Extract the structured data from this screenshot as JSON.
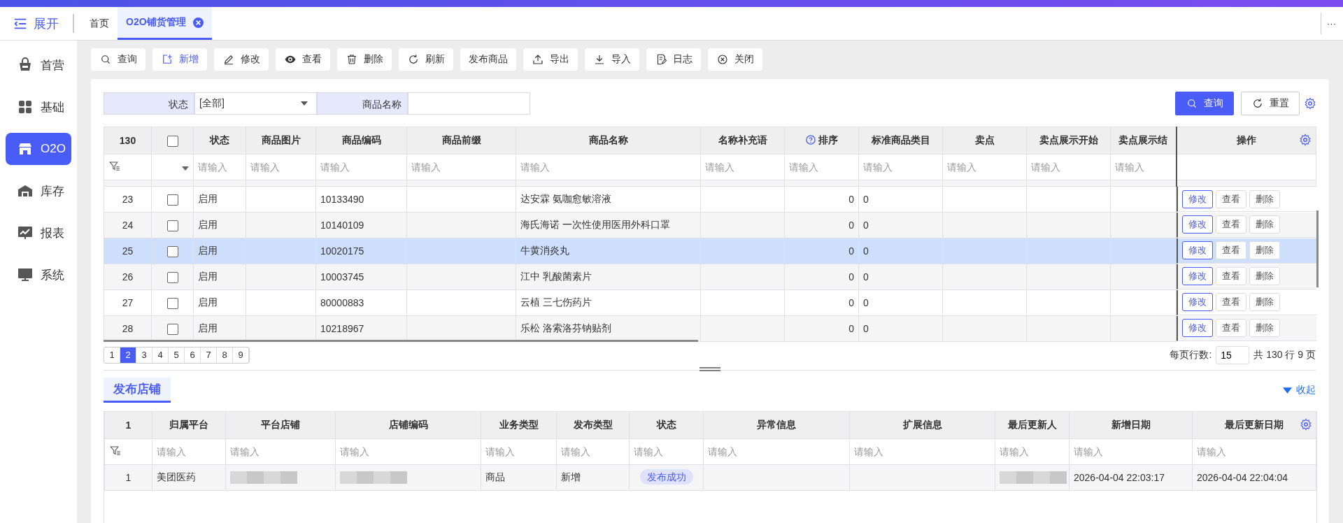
{
  "top_bar": {
    "toggle": "展开",
    "more": "···"
  },
  "tabs": [
    {
      "label": "首页",
      "selected": false,
      "closable": false
    },
    {
      "label": "O2O铺货管理",
      "selected": true,
      "closable": true
    }
  ],
  "sidebar": {
    "items": [
      {
        "label": "首营",
        "selected": false
      },
      {
        "label": "基础",
        "selected": false
      },
      {
        "label": "O2O",
        "selected": true
      },
      {
        "label": "库存",
        "selected": false
      },
      {
        "label": "报表",
        "selected": false
      },
      {
        "label": "系统",
        "selected": false
      }
    ]
  },
  "toolbar": [
    {
      "label": "查询",
      "highlighted": false
    },
    {
      "label": "新增",
      "highlighted": true
    },
    {
      "label": "修改",
      "highlighted": false
    },
    {
      "label": "查看",
      "highlighted": false
    },
    {
      "label": "删除",
      "highlighted": false
    },
    {
      "label": "刷新",
      "highlighted": false
    },
    {
      "label": "发布商品",
      "highlighted": false
    },
    {
      "label": "导出",
      "highlighted": false
    },
    {
      "label": "导入",
      "highlighted": false
    },
    {
      "label": "日志",
      "highlighted": false
    },
    {
      "label": "关闭",
      "highlighted": false
    }
  ],
  "search_form": {
    "fields": [
      {
        "label": "状态",
        "kind": "select",
        "value": "[全部]"
      },
      {
        "label": "商品名称",
        "kind": "text"
      }
    ],
    "buttons": [
      {
        "label": "查询",
        "primary": true
      },
      {
        "label": "重置",
        "primary": false
      }
    ]
  },
  "product_table": {
    "count": "130",
    "all_checked": false,
    "columns": [
      {
        "label": "状态",
        "placeholder": "请输入"
      },
      {
        "label": "商品图片",
        "placeholder": "请输入"
      },
      {
        "label": "商品编码",
        "placeholder": "请输入"
      },
      {
        "label": "商品前缀",
        "placeholder": "请输入"
      },
      {
        "label": "商品名称",
        "placeholder": "请输入"
      },
      {
        "label": "名称补充语",
        "placeholder": "请输入"
      },
      {
        "label": "排序",
        "placeholder": "请输入",
        "help": true
      },
      {
        "label": "标准商品类目",
        "placeholder": "请输入"
      },
      {
        "label": "卖点",
        "placeholder": "请输入"
      },
      {
        "label": "卖点展示开始",
        "placeholder": "请输入"
      },
      {
        "label": "卖点展示结",
        "placeholder": "请输入"
      }
    ],
    "actions_header": "操作",
    "rows": [
      {
        "no": "23",
        "checked": false,
        "selected": false,
        "status": "启用",
        "code": "10133490",
        "name": "达安霖 氨咖愈敏溶液",
        "sort": "0",
        "category": "0",
        "actions": [
          "修改",
          "查看",
          "删除"
        ]
      },
      {
        "no": "24",
        "checked": false,
        "selected": false,
        "status": "启用",
        "code": "10140109",
        "name": "海氏海诺 一次性使用医用外科口罩",
        "sort": "0",
        "category": "0",
        "actions": [
          "修改",
          "查看",
          "删除"
        ]
      },
      {
        "no": "25",
        "checked": false,
        "selected": true,
        "status": "启用",
        "code": "10020175",
        "name": "牛黄消炎丸",
        "sort": "0",
        "category": "0",
        "actions": [
          "修改",
          "查看",
          "删除"
        ]
      },
      {
        "no": "26",
        "checked": false,
        "selected": false,
        "status": "启用",
        "code": "10003745",
        "name": "江中 乳酸菌素片",
        "sort": "0",
        "category": "0",
        "actions": [
          "修改",
          "查看",
          "删除"
        ]
      },
      {
        "no": "27",
        "checked": false,
        "selected": false,
        "status": "启用",
        "code": "80000883",
        "name": "云植 三七伤药片",
        "sort": "0",
        "category": "0",
        "actions": [
          "修改",
          "查看",
          "删除"
        ]
      },
      {
        "no": "28",
        "checked": false,
        "selected": false,
        "status": "启用",
        "code": "10218967",
        "name": "乐松 洛索洛芬钠贴剂",
        "sort": "0",
        "category": "0",
        "actions": [
          "修改",
          "查看",
          "删除"
        ]
      }
    ]
  },
  "pagination": {
    "pages": [
      {
        "label": "1",
        "selected": false
      },
      {
        "label": "2",
        "selected": true
      },
      {
        "label": "3",
        "selected": false
      },
      {
        "label": "4",
        "selected": false
      },
      {
        "label": "5",
        "selected": false
      },
      {
        "label": "6",
        "selected": false
      },
      {
        "label": "7",
        "selected": false
      },
      {
        "label": "8",
        "selected": false
      },
      {
        "label": "9",
        "selected": false
      }
    ],
    "page_size_label": "每页行数:",
    "page_size": "15",
    "summary": "共 130 行 9 页"
  },
  "store_section": {
    "tab": "发布店铺",
    "collapse": "收起",
    "table": {
      "count": "1",
      "columns": [
        {
          "label": "归属平台",
          "placeholder": "请输入"
        },
        {
          "label": "平台店铺",
          "placeholder": "请输入"
        },
        {
          "label": "店铺编码",
          "placeholder": "请输入"
        },
        {
          "label": "业务类型",
          "placeholder": "请输入"
        },
        {
          "label": "发布类型",
          "placeholder": "请输入"
        },
        {
          "label": "状态",
          "placeholder": "请输入"
        },
        {
          "label": "异常信息",
          "placeholder": "请输入"
        },
        {
          "label": "扩展信息",
          "placeholder": "请输入"
        },
        {
          "label": "最后更新人",
          "placeholder": "请输入"
        },
        {
          "label": "新增日期",
          "placeholder": "请输入"
        },
        {
          "label": "最后更新日期",
          "placeholder": "请输入"
        }
      ],
      "rows": [
        {
          "no": "1",
          "platform": "美团医药",
          "business_type": "商品",
          "publish_type": "新增",
          "status": "发布成功",
          "created": "2026-04-04 22:03:17",
          "updated": "2026-04-04 22:04:04"
        }
      ]
    }
  }
}
